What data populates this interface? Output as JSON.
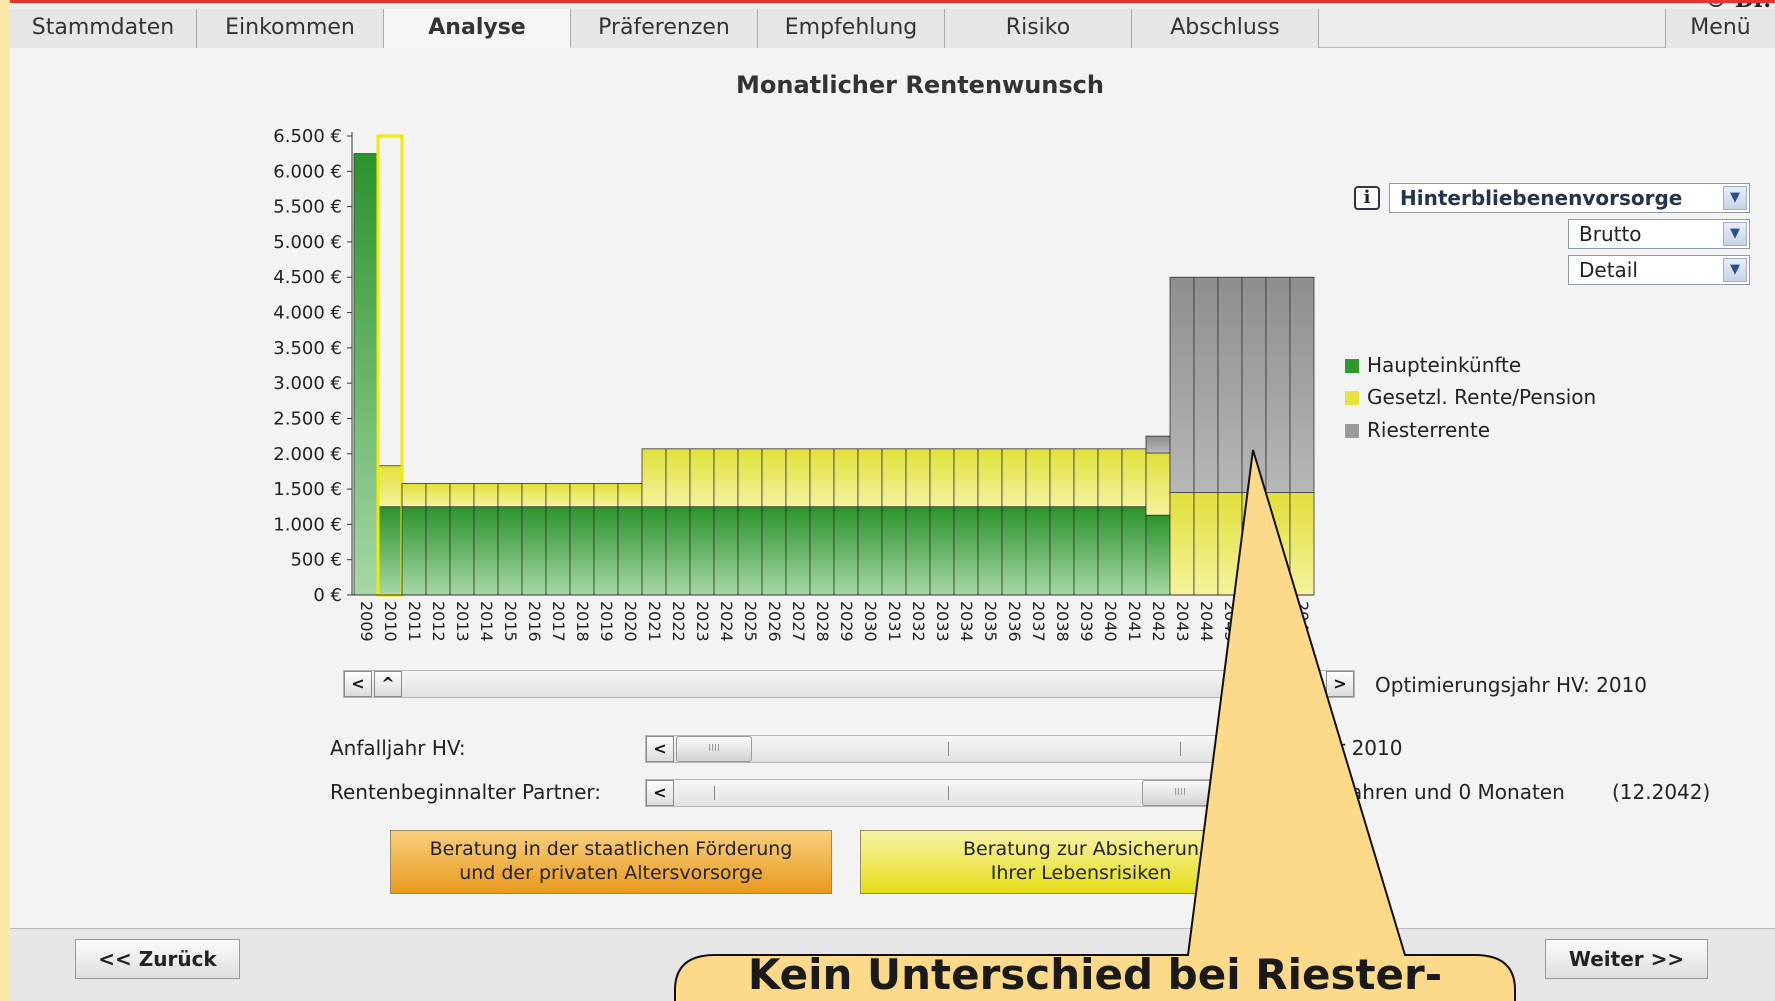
{
  "tabs": [
    "Stammdaten",
    "Einkommen",
    "Analyse",
    "Präferenzen",
    "Empfehlung",
    "Risiko",
    "Abschluss"
  ],
  "active_tab": "Analyse",
  "menu_label": "Menü",
  "copyright_fragment": "© Dr.",
  "chart_title": "Monatlicher Rentenwunsch",
  "info_label": "i",
  "selects": {
    "vorsorge": "Hinterbliebenenvorsorge",
    "basis": "Brutto",
    "ansicht": "Detail"
  },
  "legend": [
    {
      "label": "Haupteinkünfte",
      "color": "#2e9a2e"
    },
    {
      "label": "Gesetzl. Rente/Pension",
      "color": "#e6e33a"
    },
    {
      "label": "Riesterrente",
      "color": "#9a9a9a"
    }
  ],
  "optimierung": {
    "label": "Optimierungsjahr HV:",
    "value": "2010"
  },
  "anfalljahr": {
    "label": "Anfalljahr HV:",
    "value_fragment": "r 2010"
  },
  "rentenbeginn": {
    "label": "Rentenbeginnalter Partner:",
    "value_fragment": "ahren und 0 Monaten",
    "date": "(12.2042)"
  },
  "buttons": {
    "foerderung_line1": "Beratung in der staatlichen Förderung",
    "foerderung_line2": "und der privaten Altersvorsorge",
    "absicherung_line1": "Beratung zur Absicherun",
    "absicherung_line2": "Ihrer Lebensrisiken"
  },
  "nav": {
    "back": "<< Zurück",
    "next": "Weiter >>"
  },
  "callout_text": "Kein Unterschied bei Riester-",
  "chart_data": {
    "type": "bar",
    "title": "Monatlicher Rentenwunsch",
    "ylim": [
      0,
      6500
    ],
    "yticks": [
      "0 €",
      "500 €",
      "1.000 €",
      "1.500 €",
      "2.000 €",
      "2.500 €",
      "3.000 €",
      "3.500 €",
      "4.000 €",
      "4.500 €",
      "5.000 €",
      "5.500 €",
      "6.000 €",
      "6.500 €"
    ],
    "categories": [
      "2009",
      "2010",
      "2011",
      "2012",
      "2013",
      "2014",
      "2015",
      "2016",
      "2017",
      "2018",
      "2019",
      "2020",
      "2021",
      "2022",
      "2023",
      "2024",
      "2025",
      "2026",
      "2027",
      "2028",
      "2029",
      "2030",
      "2031",
      "2032",
      "2033",
      "2034",
      "2035",
      "2036",
      "2037",
      "2038",
      "2039",
      "2040",
      "2041",
      "2042",
      "2043",
      "2044",
      "2045",
      "2046",
      "2047",
      "2048"
    ],
    "series": [
      {
        "name": "Haupteinkünfte",
        "values": [
          6250,
          1250,
          1250,
          1250,
          1250,
          1250,
          1250,
          1250,
          1250,
          1250,
          1250,
          1250,
          1250,
          1250,
          1250,
          1250,
          1250,
          1250,
          1250,
          1250,
          1250,
          1250,
          1250,
          1250,
          1250,
          1250,
          1250,
          1250,
          1250,
          1250,
          1250,
          1250,
          1250,
          1130,
          0,
          0,
          0,
          0,
          0,
          0
        ]
      },
      {
        "name": "Gesetzl. Rente/Pension",
        "values": [
          0,
          580,
          330,
          330,
          330,
          330,
          330,
          330,
          330,
          330,
          330,
          330,
          820,
          820,
          820,
          820,
          820,
          820,
          820,
          820,
          820,
          820,
          820,
          820,
          820,
          820,
          820,
          820,
          820,
          820,
          820,
          820,
          820,
          880,
          1450,
          1450,
          1450,
          1450,
          1450,
          1450
        ]
      },
      {
        "name": "Riesterrente",
        "values": [
          0,
          0,
          0,
          0,
          0,
          0,
          0,
          0,
          0,
          0,
          0,
          0,
          0,
          0,
          0,
          0,
          0,
          0,
          0,
          0,
          0,
          0,
          0,
          0,
          0,
          0,
          0,
          0,
          0,
          0,
          0,
          0,
          0,
          240,
          3050,
          3050,
          3050,
          3050,
          3050,
          3050
        ]
      }
    ],
    "highlight_category": "2010",
    "grid": false,
    "legend_position": "right"
  }
}
